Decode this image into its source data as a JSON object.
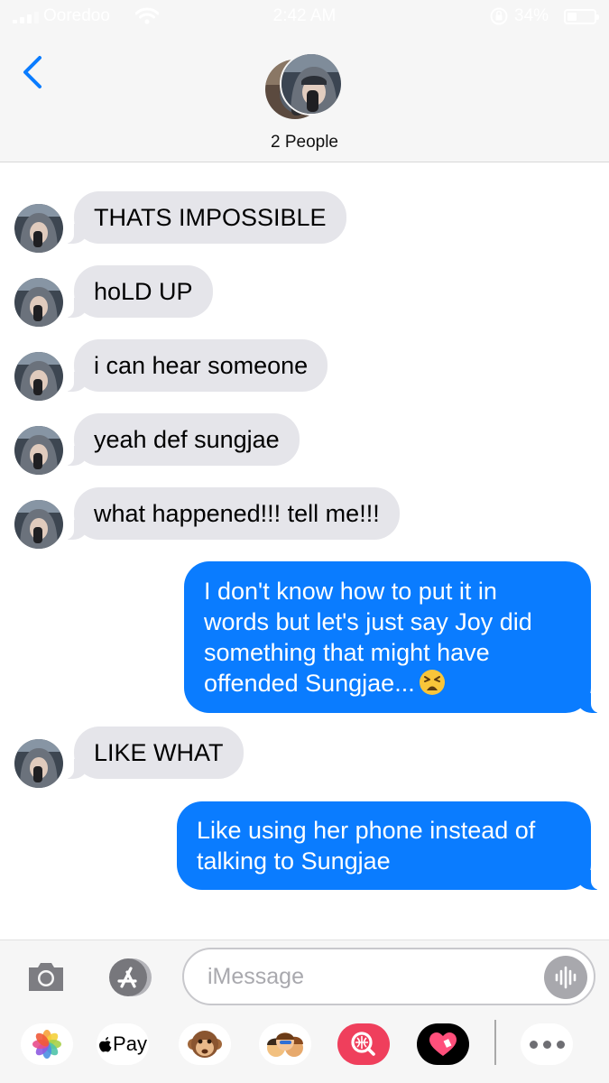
{
  "status_bar": {
    "carrier": "Ooredoo",
    "time": "2:42 AM",
    "battery_percent": "34%",
    "battery_level": 0.34,
    "icons": [
      "signal-icon",
      "wifi-icon",
      "orientation-lock-icon",
      "battery-icon"
    ]
  },
  "header": {
    "back_icon": "chevron-left-icon",
    "group_label": "2 People"
  },
  "messages": [
    {
      "direction": "incoming",
      "text": "THATS IMPOSSIBLE"
    },
    {
      "direction": "incoming",
      "text": "hoLD UP"
    },
    {
      "direction": "incoming",
      "text": "i can hear someone"
    },
    {
      "direction": "incoming",
      "text": "yeah def sungjae"
    },
    {
      "direction": "incoming",
      "text": "what happened!!! tell me!!!"
    },
    {
      "direction": "outgoing",
      "lines": [
        "I don't know how to put it in",
        "words but let's just say Joy did",
        "something that might have",
        "offended Sungjae..."
      ],
      "emoji": "tired-face-emoji"
    },
    {
      "direction": "incoming",
      "text": "LIKE WHAT"
    },
    {
      "direction": "outgoing",
      "lines": [
        "Like using her phone instead of",
        "talking to Sungjae"
      ]
    }
  ],
  "composer": {
    "placeholder": "iMessage",
    "camera_icon": "camera-icon",
    "appstore_icon": "app-store-icon",
    "audio_icon": "waveform-icon"
  },
  "app_drawer": {
    "apple_pay_label": "Pay",
    "apps": [
      "photos-icon",
      "apple-pay-icon",
      "monkey-emoji-icon",
      "memoji-icon",
      "image-search-icon",
      "heart-sticker-icon",
      "more-icon"
    ]
  },
  "colors": {
    "outgoing_bubble": "#0a7cff",
    "incoming_bubble": "#e5e5ea",
    "header_bg": "#f6f6f6",
    "link_blue": "#0a7cff"
  }
}
